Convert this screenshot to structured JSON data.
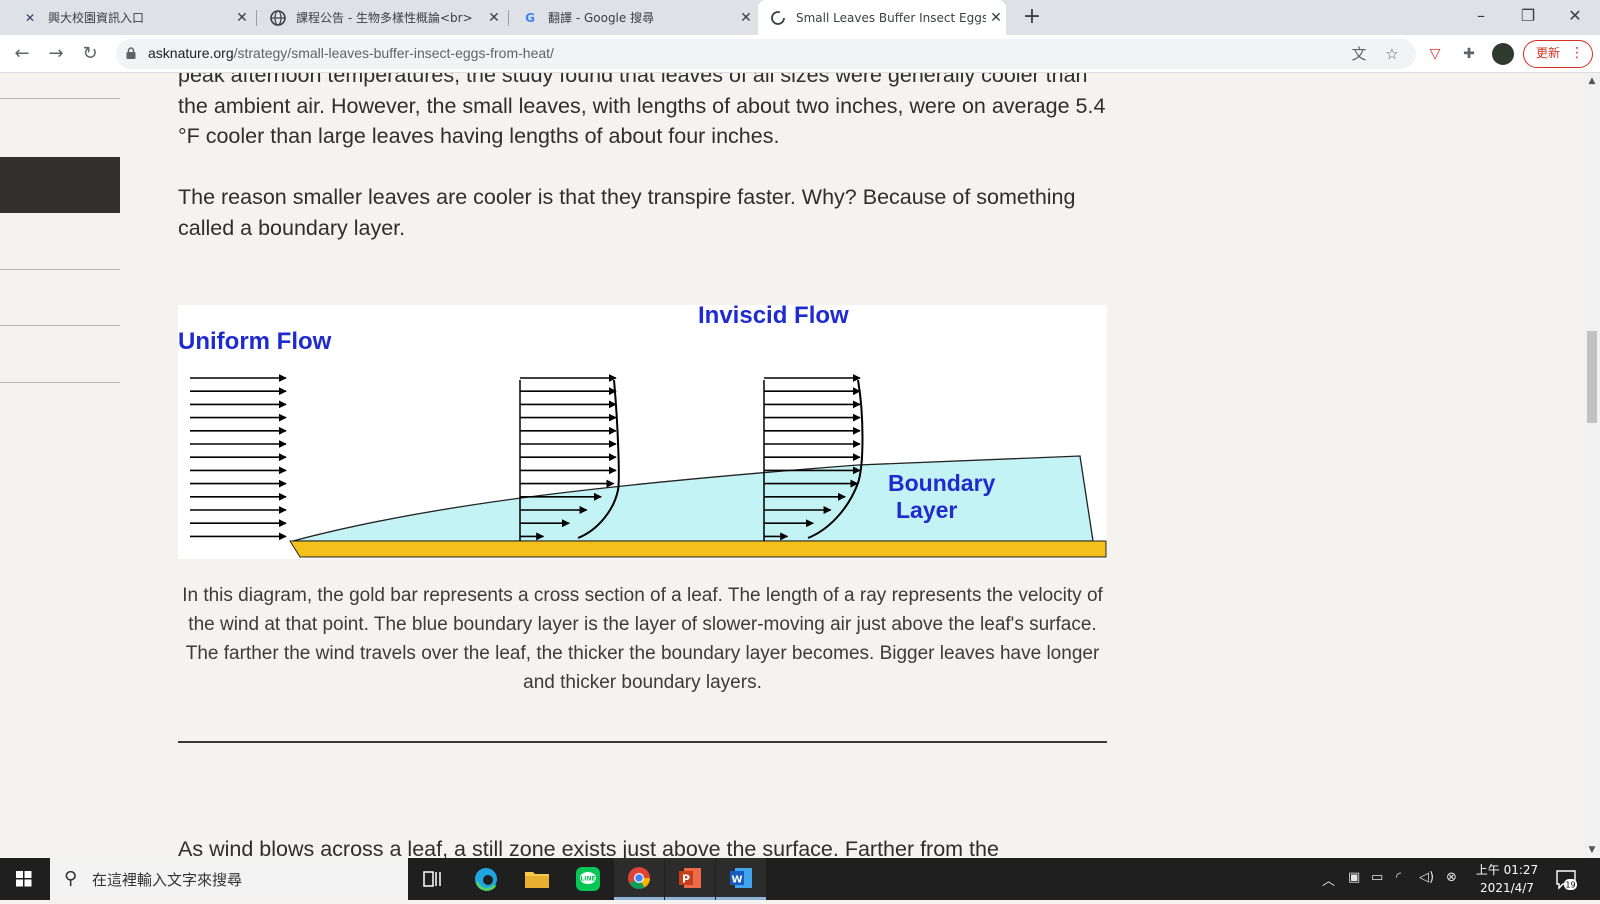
{
  "browser": {
    "tabs": [
      {
        "title": "興大校園資訊入口",
        "active": false
      },
      {
        "title": "課程公告 - 生物多樣性概論<br>",
        "active": false
      },
      {
        "title": "翻譯 - Google 搜尋",
        "active": false
      },
      {
        "title": "Small Leaves Buffer Insect Eggs",
        "active": true
      }
    ],
    "new_tab": "+",
    "url_host": "asknature.org",
    "url_path": "/strategy/small-leaves-buffer-insect-eggs-from-heat/",
    "update_label": "更新"
  },
  "article": {
    "p1": "peak afternoon temperatures, the study found that leaves of all sizes were generally cooler than the ambient air. However, the small leaves, with lengths of about two inches, were on average 5.4 °F cooler than large leaves having lengths of about four inches.",
    "p2": "The reason smaller leaves are cooler is that they transpire faster. Why? Because of something called a boundary layer.",
    "diagram": {
      "label_uniform": "Uniform Flow",
      "label_inviscid": "Inviscid Flow",
      "label_boundary_1": "Boundary",
      "label_boundary_2": "Layer",
      "colors": {
        "leaf": "#f3c11c",
        "boundary": "#c4f3f5",
        "label": "#1f2bd1"
      }
    },
    "caption": "In this diagram, the gold bar represents a cross section of a leaf. The length of a ray represents the velocity of the wind at that point. The blue boundary layer is the layer of slower-moving air just above the leaf's surface. The farther the wind travels over the leaf, the thicker the boundary layer becomes. Bigger leaves have longer and thicker boundary layers.",
    "p3": "As wind blows across a leaf, a still zone exists just above the surface. Farther from the"
  },
  "taskbar": {
    "search_placeholder": "在這裡輸入文字來搜尋",
    "time": "上午 01:27",
    "date": "2021/4/7",
    "notification_count": "19"
  }
}
